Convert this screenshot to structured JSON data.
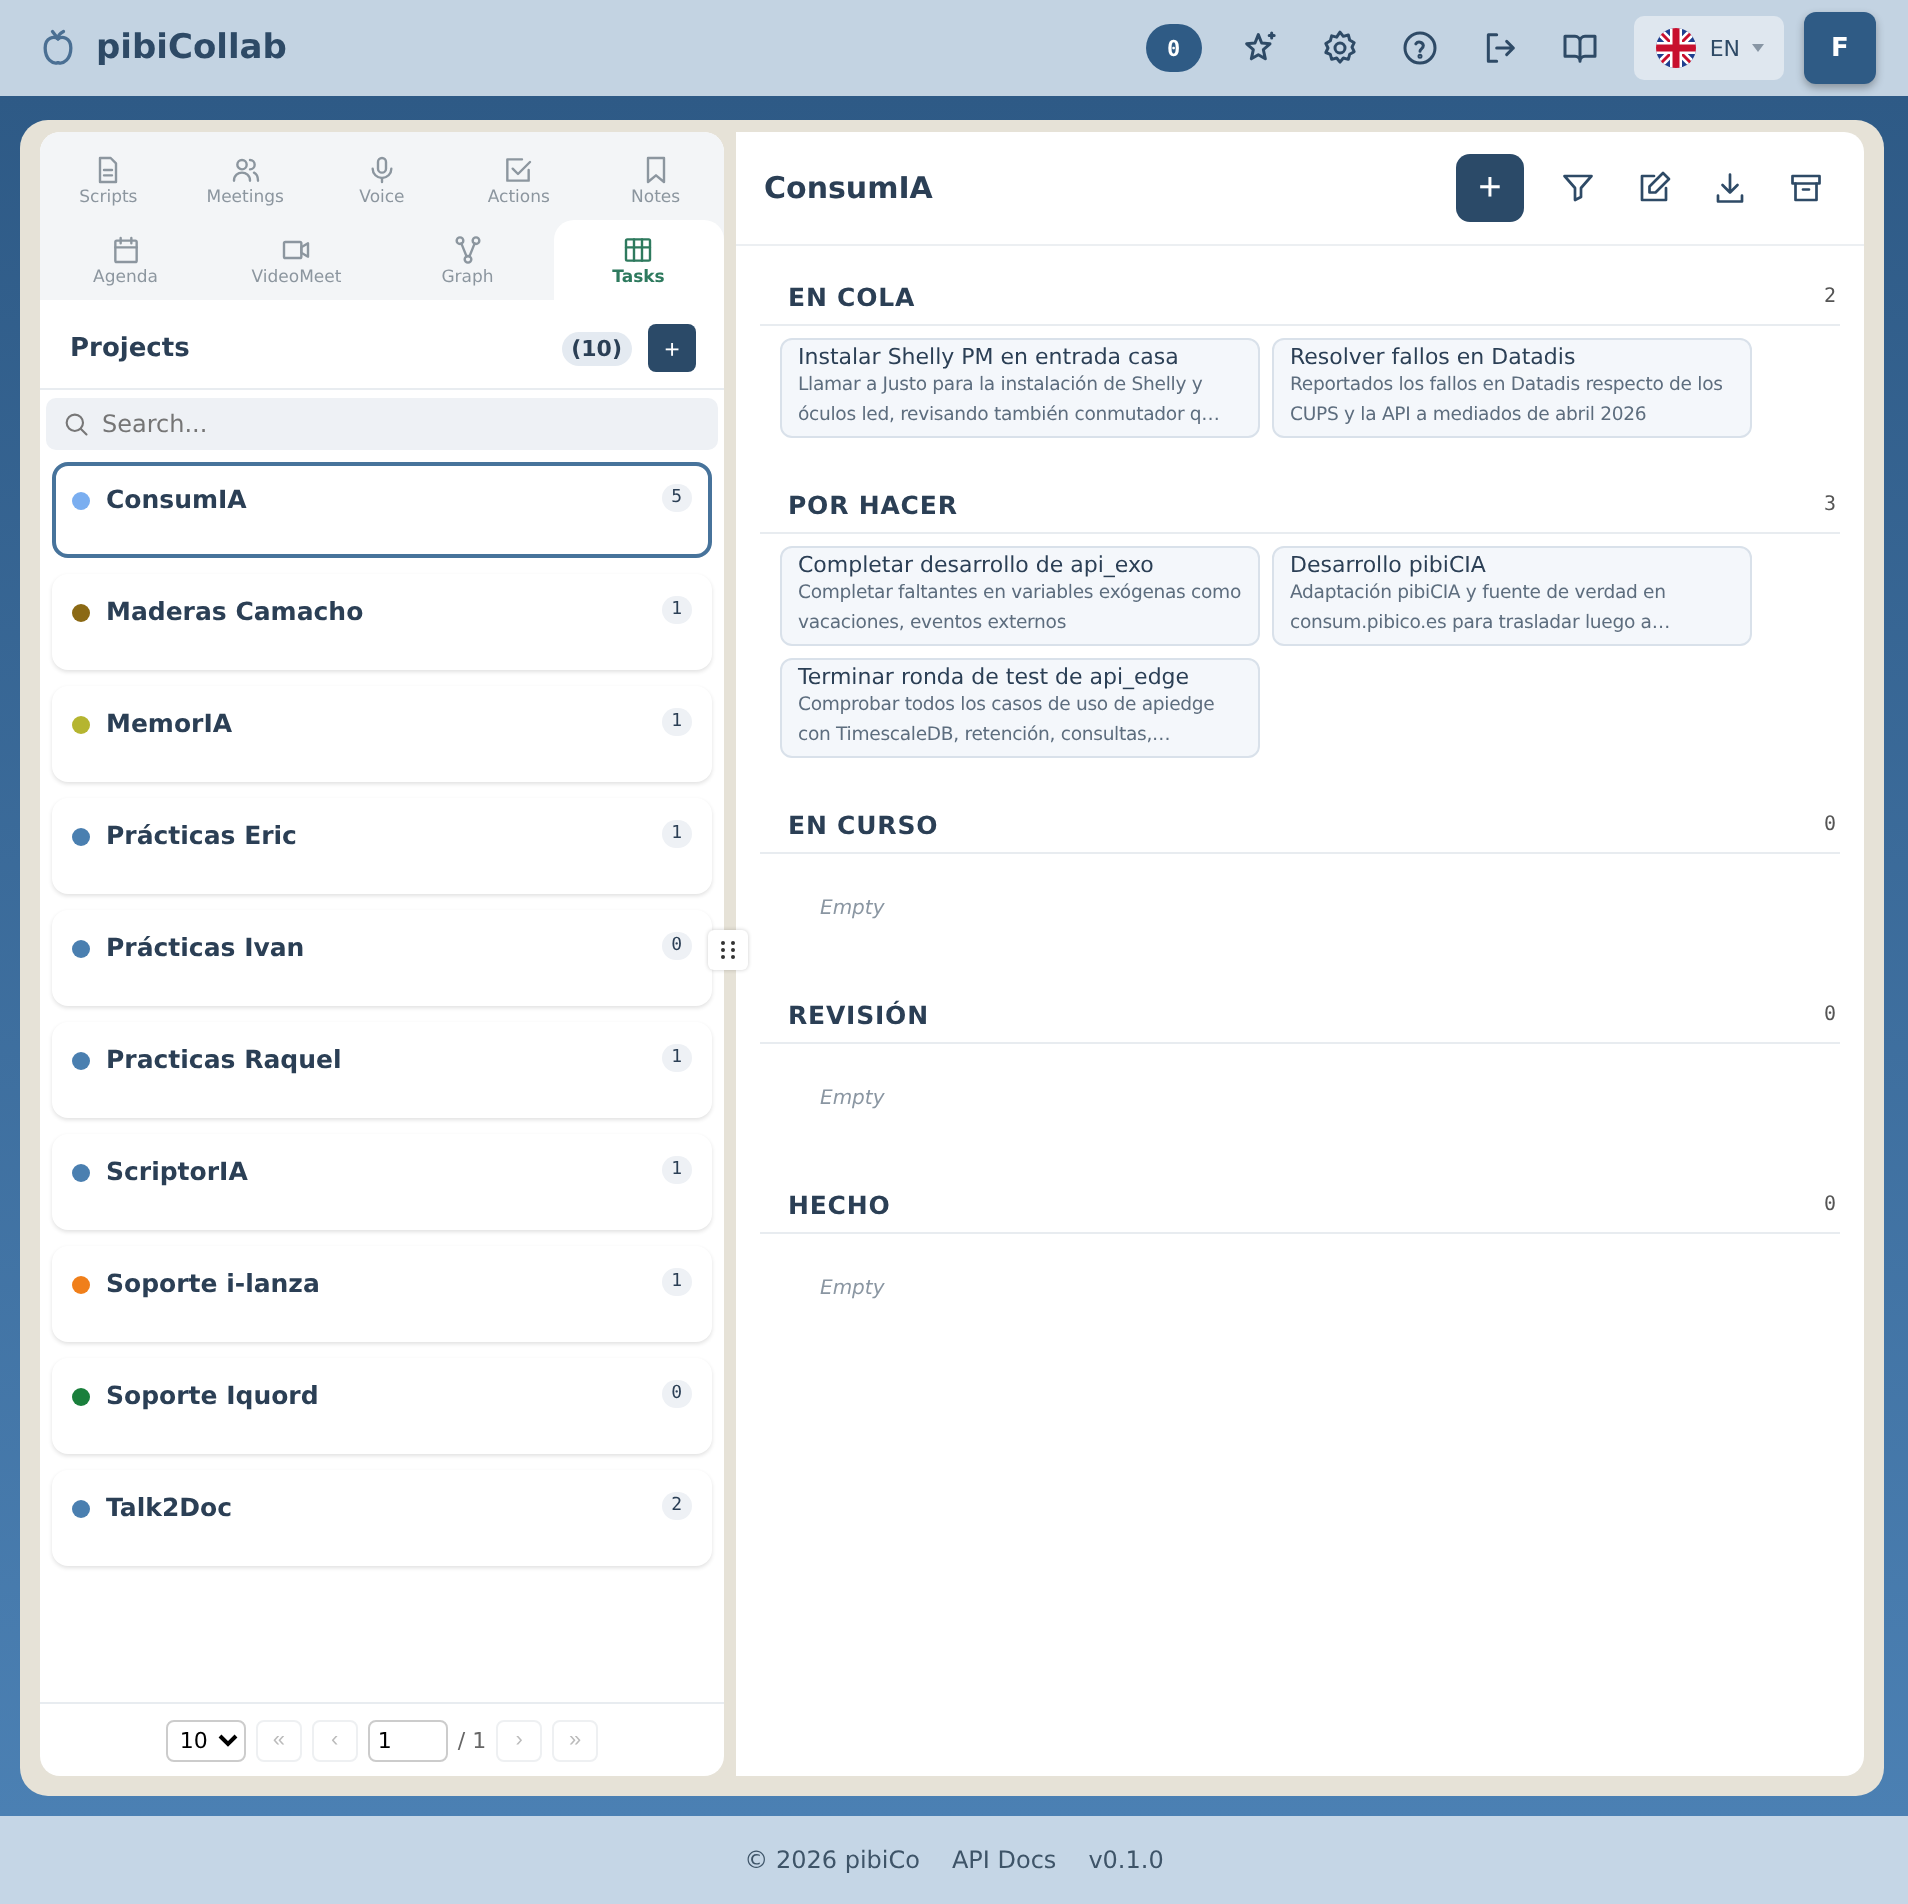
{
  "app": {
    "name": "pibiCollab"
  },
  "header": {
    "notifications": "0",
    "language": "EN",
    "avatar": "F"
  },
  "tabs": [
    {
      "label": "Scripts",
      "kind": "file",
      "selected": false
    },
    {
      "label": "Meetings",
      "kind": "people",
      "selected": false
    },
    {
      "label": "Voice",
      "kind": "mic",
      "selected": false
    },
    {
      "label": "Actions",
      "kind": "check",
      "selected": false
    },
    {
      "label": "Notes",
      "kind": "bookmark",
      "selected": false
    },
    {
      "label": "Agenda",
      "kind": "calendar",
      "selected": false
    },
    {
      "label": "VideoMeet",
      "kind": "video",
      "selected": false
    },
    {
      "label": "Graph",
      "kind": "graph",
      "selected": false
    },
    {
      "label": "Tasks",
      "kind": "grid",
      "selected": true
    }
  ],
  "projects": {
    "title": "Projects",
    "count": "(10)",
    "add": "+",
    "search_placeholder": "Search...",
    "items": [
      {
        "name": "ConsumIA",
        "count": "5",
        "color": "#7aaef0",
        "selected": true
      },
      {
        "name": "Maderas Camacho",
        "count": "1",
        "color": "#8b6914",
        "selected": false
      },
      {
        "name": "MemorIA",
        "count": "1",
        "color": "#b5b530",
        "selected": false
      },
      {
        "name": "Prácticas Eric",
        "count": "1",
        "color": "#4a7fb0",
        "selected": false
      },
      {
        "name": "Prácticas Ivan",
        "count": "0",
        "color": "#4a7fb0",
        "selected": false
      },
      {
        "name": "Practicas Raquel",
        "count": "1",
        "color": "#4a7fb0",
        "selected": false
      },
      {
        "name": "ScriptorIA",
        "count": "1",
        "color": "#4a7fb0",
        "selected": false
      },
      {
        "name": "Soporte i-lanza",
        "count": "1",
        "color": "#f07f1a",
        "selected": false
      },
      {
        "name": "Soporte Iquord",
        "count": "0",
        "color": "#1a7f3c",
        "selected": false
      },
      {
        "name": "Talk2Doc",
        "count": "2",
        "color": "#4a7fb0",
        "selected": false
      }
    ]
  },
  "pagination": {
    "page_size": "10",
    "first": "«",
    "prev": "‹",
    "page": "1",
    "total": "/ 1",
    "next": "›",
    "last": "»"
  },
  "board": {
    "title": "ConsumIA",
    "add": "+",
    "columns": [
      {
        "title": "EN COLA",
        "count": "2",
        "cards": [
          {
            "title": "Instalar Shelly PM en entrada casa",
            "description": "Llamar a Justo para la instalación de Shelly y óculos led, revisando también conmutador q…"
          },
          {
            "title": "Resolver fallos en Datadis",
            "description": "Reportados los fallos en Datadis respecto de los CUPS y la API a mediados de abril 2026"
          }
        ]
      },
      {
        "title": "POR HACER",
        "count": "3",
        "cards": [
          {
            "title": "Completar desarrollo de api_exo",
            "description": "Completar faltantes en variables exógenas como vacaciones, eventos externos"
          },
          {
            "title": "Desarrollo pibiCIA",
            "description": "Adaptación pibiCIA y fuente de verdad en consum.pibico.es para trasladar luego a…"
          },
          {
            "title": "Terminar ronda de test de api_edge",
            "description": "Comprobar todos los casos de uso de apiedge con TimescaleDB, retención, consultas,…"
          }
        ]
      },
      {
        "title": "EN CURSO",
        "count": "0",
        "empty": "Empty"
      },
      {
        "title": "REVISIÓN",
        "count": "0",
        "empty": "Empty"
      },
      {
        "title": "HECHO",
        "count": "0",
        "empty": "Empty"
      }
    ]
  },
  "footer": [
    "© 2026 pibiCo",
    "API Docs",
    "v0.1.0"
  ]
}
